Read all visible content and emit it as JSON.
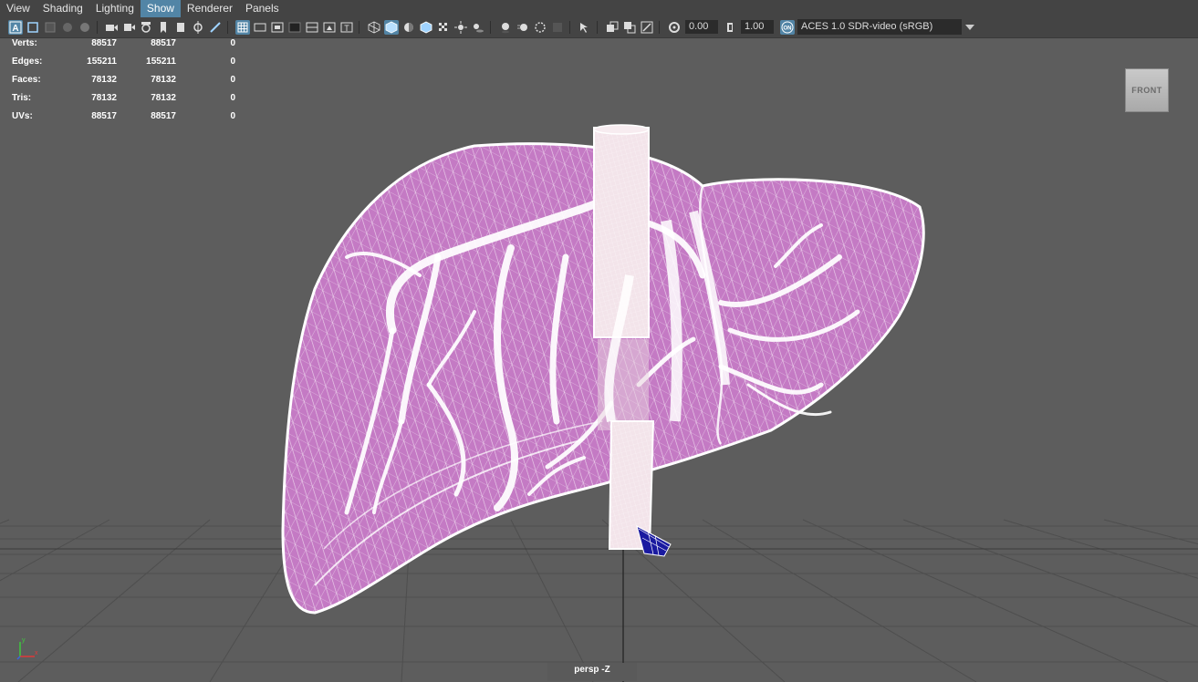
{
  "menu": {
    "items": [
      "View",
      "Shading",
      "Lighting",
      "Show",
      "Renderer",
      "Panels"
    ],
    "active": "Show"
  },
  "toolbar": {
    "exposure_value": "0.00",
    "gamma_value": "1.00",
    "color_space": "ACES 1.0 SDR-video (sRGB)"
  },
  "hud": {
    "rows": [
      {
        "label": "Verts:",
        "v1": "88517",
        "v2": "88517",
        "v3": "0"
      },
      {
        "label": "Edges:",
        "v1": "155211",
        "v2": "155211",
        "v3": "0"
      },
      {
        "label": "Faces:",
        "v1": "78132",
        "v2": "78132",
        "v3": "0"
      },
      {
        "label": "Tris:",
        "v1": "78132",
        "v2": "78132",
        "v3": "0"
      },
      {
        "label": "UVs:",
        "v1": "88517",
        "v2": "88517",
        "v3": "0"
      }
    ]
  },
  "viewcube": {
    "label": "FRONT"
  },
  "camera": {
    "label": "persp -Z"
  },
  "colors": {
    "menubar_bg": "#444444",
    "active_accent": "#5285a6",
    "viewport_bg": "#5d5d5d",
    "mesh_fill": "#c47ac4",
    "wireframe": "#ffffff",
    "selected_faces": "#1a1aa0"
  }
}
